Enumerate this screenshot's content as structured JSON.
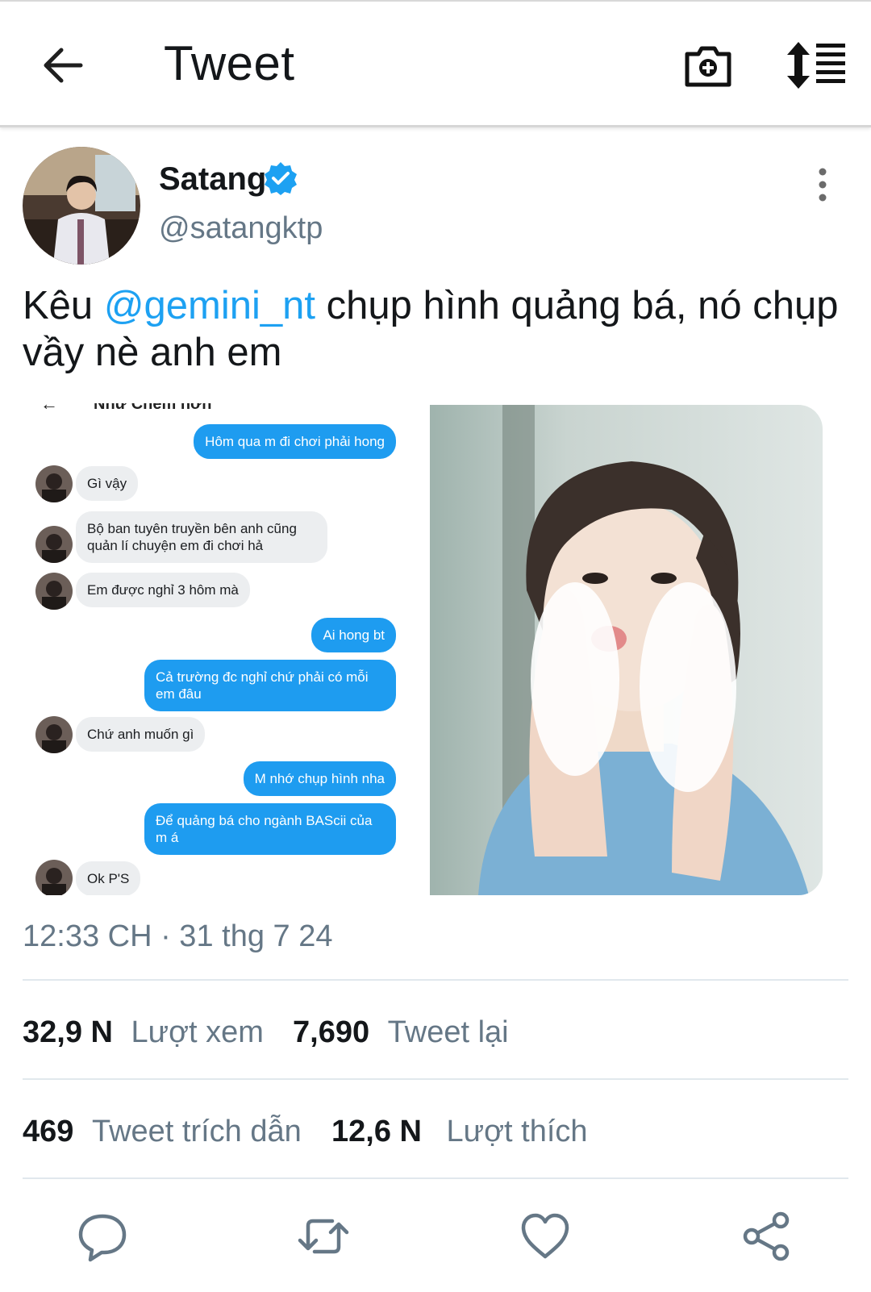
{
  "header": {
    "title": "Tweet",
    "back_icon": "arrow-left-icon",
    "camera_icon": "camera-add-icon",
    "sort_icon": "sort-list-icon"
  },
  "author": {
    "name": "Satang",
    "handle": "@satangktp",
    "verified_color": "#1da1f2"
  },
  "tweet": {
    "text_before": "Kêu ",
    "mention": "@gemini_nt",
    "text_after": " chụp hình quảng bá, nó chụp vầy nè anh em",
    "timestamp": "12:33 CH · 31 thg 7 24"
  },
  "chat_screenshot": {
    "header_title": "Nhữ Chém hơn",
    "messages": [
      {
        "side": "out",
        "text": "Hôm qua m đi chơi phải hong"
      },
      {
        "side": "in",
        "text": "Gì vậy"
      },
      {
        "side": "in",
        "text": "Bộ ban tuyên truyền bên anh cũng quản lí chuyện em đi chơi hả"
      },
      {
        "side": "in",
        "text": "Em được nghỉ 3 hôm mà"
      },
      {
        "side": "out",
        "text": "Ai hong bt"
      },
      {
        "side": "out",
        "text": "Cả trường đc nghỉ chứ phải có mỗi em đâu"
      },
      {
        "side": "in",
        "text": "Chứ anh muốn gì"
      },
      {
        "side": "out",
        "text": "M nhớ chụp hình nha"
      },
      {
        "side": "out",
        "text": "Để quảng bá cho ngành BAScii của m á"
      },
      {
        "side": "in",
        "text": "Ok P'S"
      }
    ]
  },
  "stats": {
    "views_count": "32,9 N",
    "views_label": "Lượt xem",
    "retweets_count": "7,690",
    "retweets_label": "Tweet lại",
    "quotes_count": "469",
    "quotes_label": "Tweet trích dẫn",
    "likes_count": "12,6 N",
    "likes_label": "Lượt thích"
  },
  "actions": [
    "reply-icon",
    "retweet-icon",
    "like-icon",
    "share-icon"
  ],
  "colors": {
    "accent": "#1da1f2",
    "muted": "#657786",
    "bubble_out": "#1e9cf0",
    "bubble_in": "#eceef0"
  }
}
